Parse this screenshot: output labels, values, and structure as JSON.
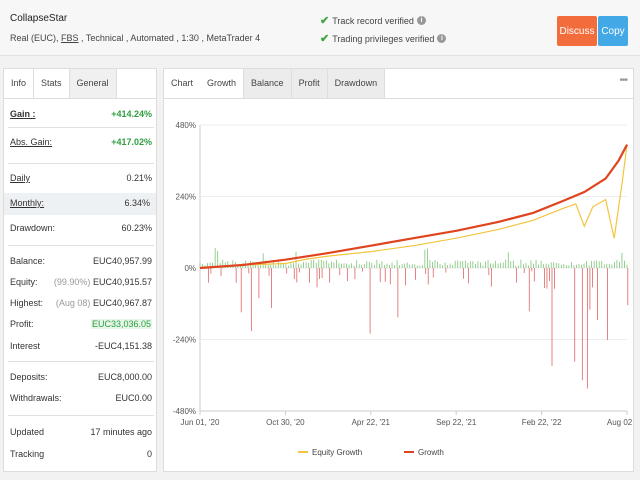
{
  "header": {
    "account_name": "CollapseStar",
    "desc_part1": "Real (EUC), ",
    "desc_broker": "FBS",
    "desc_part2": " , Technical , Automated , 1:30 , MetaTrader 4",
    "track_record": "Track record verified",
    "trading_priv": "Trading privileges verified",
    "discuss_label": "Discuss",
    "copy_label": "Copy"
  },
  "left_tabs": [
    "Info",
    "Stats",
    "General"
  ],
  "stats": {
    "gain_label": "Gain :",
    "gain": "+414.24%",
    "abs_gain_label": "Abs. Gain:",
    "abs_gain": "+417.02%",
    "daily_label": "Daily",
    "daily": "0.21%",
    "monthly_label": "Monthly:",
    "monthly": "6.34%",
    "drawdown_label": "Drawdown:",
    "drawdown": "60.23%",
    "balance_label": "Balance:",
    "balance": "EUC40,957.99",
    "equity_label": "Equity:",
    "equity_pct": "(99.90%)",
    "equity": "EUC40,915.57",
    "highest_label": "Highest:",
    "highest_date": "(Aug 08)",
    "highest": "EUC40,967.87",
    "profit_label": "Profit:",
    "profit": "EUC33,036.05",
    "interest_label": "Interest",
    "interest": "-EUC4,151.38",
    "deposits_label": "Deposits:",
    "deposits": "EUC8,000.00",
    "withdrawals_label": "Withdrawals:",
    "withdrawals": "EUC0.00",
    "updated_label": "Updated",
    "updated": "17 minutes ago",
    "tracking_label": "Tracking",
    "tracking": "0"
  },
  "chart_tabs": [
    "Chart",
    "Growth",
    "Balance",
    "Profit",
    "Drawdown"
  ],
  "more_label": "•••",
  "colors": {
    "growth": "#e0441f",
    "equity": "#f2c53d",
    "pos_bar": "#7cc576",
    "neg_bar": "#e06363"
  },
  "chart_data": {
    "type": "line",
    "y_ticks": [
      "480%",
      "240%",
      "0%",
      "-240%",
      "-480%"
    ],
    "ylim": [
      -480,
      480
    ],
    "x_tick_labels": [
      "Jun 01, '20",
      "Oct 30, '20",
      "Apr 22, '21",
      "Sep 22, '21",
      "Feb 22, '22",
      "Aug 02, '22"
    ],
    "x_tick_pos": [
      0,
      0.2,
      0.4,
      0.6,
      0.8,
      1.0
    ],
    "series": [
      {
        "name": "Equity Growth",
        "x": [
          0,
          0.1,
          0.2,
          0.25,
          0.3,
          0.4,
          0.5,
          0.6,
          0.7,
          0.78,
          0.85,
          0.88,
          0.9,
          0.92,
          0.95,
          0.97,
          0.99,
          1.0
        ],
        "y": [
          0,
          10,
          15,
          30,
          40,
          55,
          75,
          100,
          130,
          160,
          200,
          215,
          140,
          205,
          230,
          100,
          300,
          415
        ]
      },
      {
        "name": "Growth",
        "x": [
          0,
          0.1,
          0.2,
          0.3,
          0.4,
          0.5,
          0.6,
          0.7,
          0.78,
          0.85,
          0.9,
          0.95,
          0.98,
          1.0
        ],
        "y": [
          0,
          10,
          28,
          50,
          75,
          100,
          125,
          155,
          185,
          225,
          255,
          300,
          360,
          414
        ]
      }
    ]
  }
}
